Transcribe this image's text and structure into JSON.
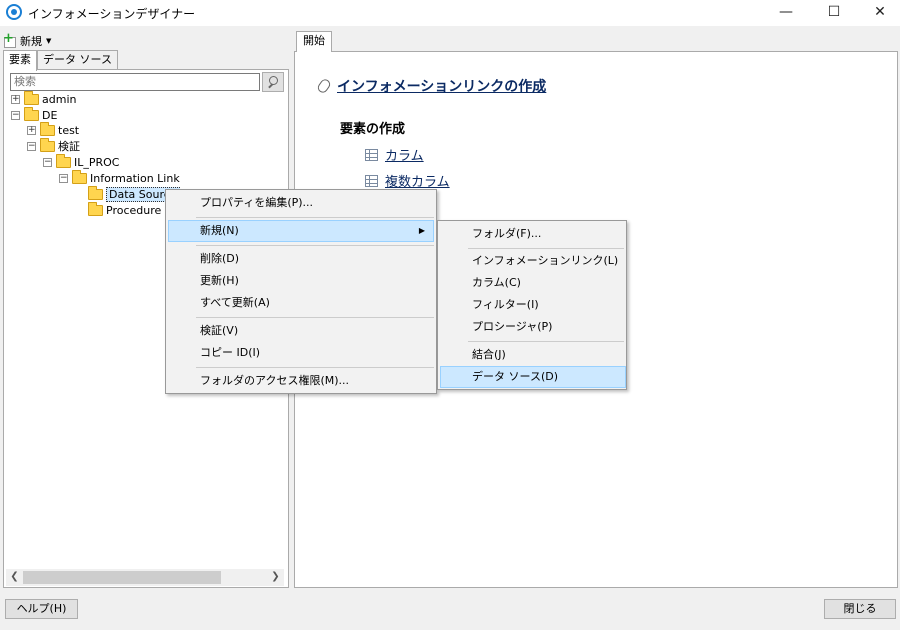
{
  "window": {
    "title": "インフォメーションデザイナー",
    "minimize": "—",
    "maximize": "☐",
    "close": "✕"
  },
  "left": {
    "new_label": "新規",
    "tabs": [
      "要素",
      "データ ソース"
    ],
    "search_placeholder": "検索",
    "tree": {
      "admin": "admin",
      "de": "DE",
      "test": "test",
      "kensho": "検証",
      "il_proc": "IL_PROC",
      "info_link": "Information Link",
      "data_source": "Data Source",
      "procedure": "Procedure"
    }
  },
  "right": {
    "tab": "開始",
    "main_link": "インフォメーションリンクの作成",
    "section_title": "要素の作成",
    "links": [
      "カラム",
      "複数カラム"
    ]
  },
  "context_menu": {
    "items": [
      "プロパティを編集(P)...",
      "新規(N)",
      "削除(D)",
      "更新(H)",
      "すべて更新(A)",
      "検証(V)",
      "コピー ID(I)",
      "フォルダのアクセス権限(M)..."
    ]
  },
  "submenu": {
    "items": [
      "フォルダ(F)...",
      "インフォメーションリンク(L)",
      "カラム(C)",
      "フィルター(I)",
      "プロシージャ(P)",
      "結合(J)",
      "データ ソース(D)"
    ]
  },
  "footer": {
    "help": "ヘルプ(H)",
    "close": "閉じる"
  }
}
